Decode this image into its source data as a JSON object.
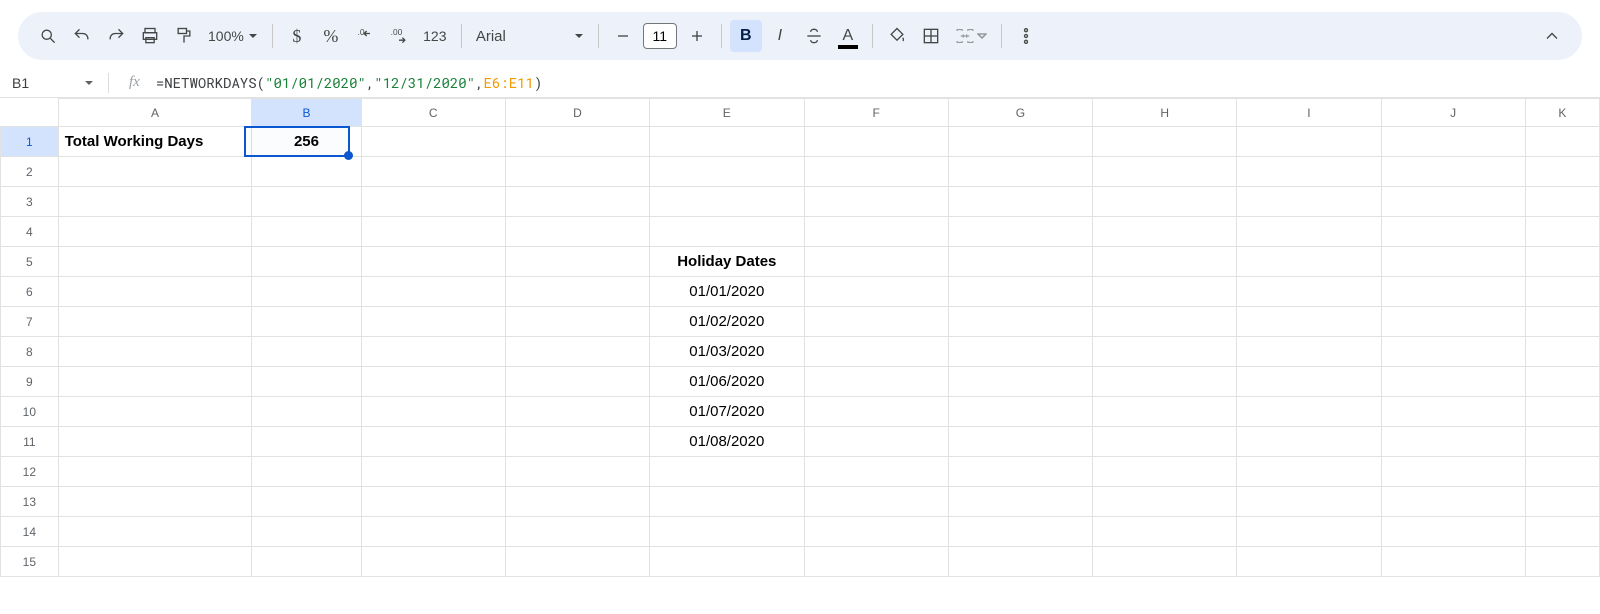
{
  "toolbar": {
    "zoom": "100%",
    "font": "Arial",
    "font_size": "11",
    "number_label": "123"
  },
  "formula_bar": {
    "cell_ref": "B1",
    "formula_prefix": "=",
    "formula_fn": "NETWORKDAYS",
    "formula_open": "(",
    "formula_arg1": "\"01/01/2020\"",
    "formula_comma1": ",",
    "formula_arg2": "\"12/31/2020\"",
    "formula_comma2": ",",
    "formula_arg3": "E6:E11",
    "formula_close": ")"
  },
  "columns": [
    "A",
    "B",
    "C",
    "D",
    "E",
    "F",
    "G",
    "H",
    "I",
    "J",
    "K"
  ],
  "rows": [
    "1",
    "2",
    "3",
    "4",
    "5",
    "6",
    "7",
    "8",
    "9",
    "10",
    "11",
    "12",
    "13",
    "14",
    "15"
  ],
  "cells": {
    "A1": "Total Working Days",
    "B1": "256",
    "E5": "Holiday Dates",
    "E6": "01/01/2020",
    "E7": "01/02/2020",
    "E8": "01/03/2020",
    "E9": "01/06/2020",
    "E10": "01/07/2020",
    "E11": "01/08/2020"
  },
  "selection": {
    "col": "B",
    "row": "1"
  }
}
